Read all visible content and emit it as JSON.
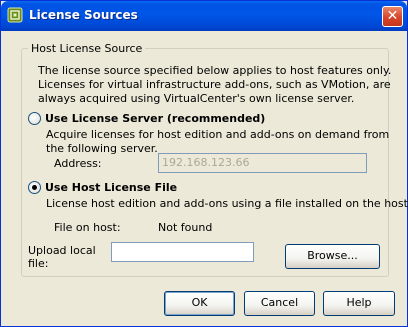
{
  "window": {
    "title": "License Sources",
    "close_glyph": "✕"
  },
  "group": {
    "legend": "Host License Source",
    "description": [
      "The license source specified below applies to host features only.",
      "Licenses for virtual infrastructure add-ons, such as VMotion, are",
      "always acquired using VirtualCenter's own license server."
    ]
  },
  "license_server": {
    "label": "Use License Server (recommended)",
    "selected": false,
    "description": [
      "Acquire licenses for host edition and add-ons on demand from",
      "the following server."
    ],
    "address_label": "Address:",
    "address_value": "192.168.123.66"
  },
  "host_license_file": {
    "label": "Use Host License File",
    "selected": true,
    "description": "License host edition and add-ons using a file installed on the host.",
    "file_on_host_label": "File on host:",
    "file_on_host_value": "Not found",
    "upload_label": [
      "Upload local",
      "file:"
    ],
    "upload_value": "",
    "browse_label": "Browse..."
  },
  "buttons": {
    "ok": "OK",
    "cancel": "Cancel",
    "help": "Help"
  },
  "colors": {
    "title_bar": "#0053e4",
    "dialog_bg": "#ece9d8",
    "close_button": "#d7462a"
  }
}
